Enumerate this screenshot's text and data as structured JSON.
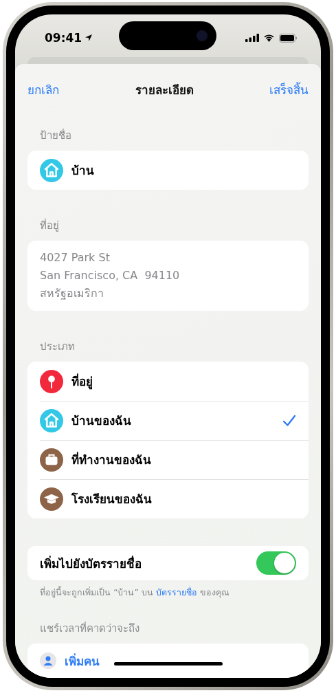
{
  "status_bar": {
    "time": "09:41"
  },
  "nav": {
    "cancel": "ยกเลิก",
    "title": "รายละเอียด",
    "done": "เสร็จสิ้น"
  },
  "label_section": {
    "header": "ป้ายชื่อ",
    "item": {
      "text": "บ้าน",
      "kind": "house",
      "color": "#32c8e6"
    }
  },
  "address_section": {
    "header": "ที่อยู่",
    "lines": [
      "4027 Park St",
      "San Francisco, CA  94110",
      "สหรัฐอเมริกา"
    ]
  },
  "type_section": {
    "header": "ประเภท",
    "options": [
      {
        "label": "ที่อยู่",
        "kind": "pin",
        "color": "#f2283c",
        "selected": false
      },
      {
        "label": "บ้านของฉัน",
        "kind": "house",
        "color": "#32c8e6",
        "selected": true
      },
      {
        "label": "ที่ทำงานของฉัน",
        "kind": "briefcase",
        "color": "#8e6448",
        "selected": false
      },
      {
        "label": "โรงเรียนของฉัน",
        "kind": "cap",
        "color": "#8e6448",
        "selected": false
      }
    ]
  },
  "contact_toggle": {
    "label": "เพิ่มไปยังบัตรรายชื่อ",
    "on": true
  },
  "footnote": {
    "before": "ที่อยู่นี้จะถูกเพิ่มเป็น “บ้าน” บน",
    "link": "บัตรรายชื่อ",
    "after": "ของคุณ"
  },
  "share_section": {
    "header": "แชร์เวลาที่คาดว่าจะถึง",
    "action": "เพิ่มคน"
  }
}
